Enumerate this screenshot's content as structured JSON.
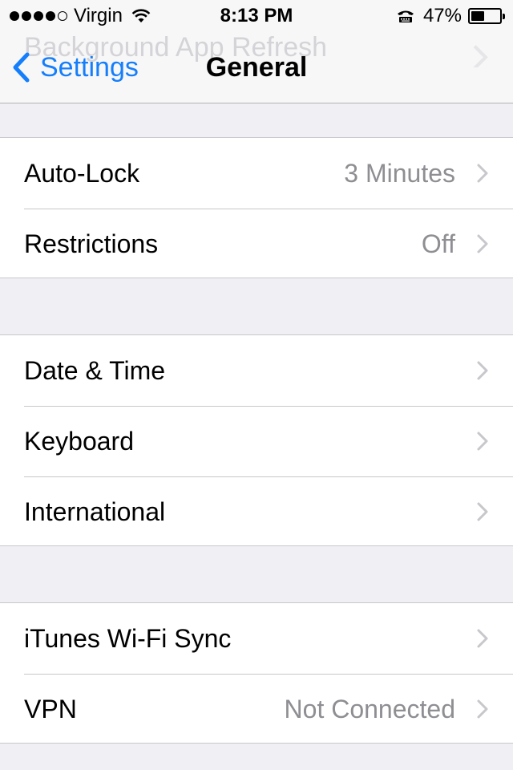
{
  "status_bar": {
    "signal_bars": 5,
    "signal_filled": 4,
    "carrier": "Virgin",
    "time": "8:13 PM",
    "battery_percent": "47%",
    "battery_level": 0.47
  },
  "nav": {
    "back_label": "Settings",
    "title": "General",
    "scrolled_under_row": "Background App Refresh"
  },
  "groups": [
    {
      "rows": [
        {
          "label": "Auto-Lock",
          "value": "3 Minutes"
        },
        {
          "label": "Restrictions",
          "value": "Off"
        }
      ]
    },
    {
      "rows": [
        {
          "label": "Date & Time",
          "value": ""
        },
        {
          "label": "Keyboard",
          "value": ""
        },
        {
          "label": "International",
          "value": ""
        }
      ]
    },
    {
      "rows": [
        {
          "label": "iTunes Wi-Fi Sync",
          "value": ""
        },
        {
          "label": "VPN",
          "value": "Not Connected"
        }
      ]
    }
  ],
  "colors": {
    "accent": "#157efb",
    "background": "#efeff4",
    "secondary_text": "#8e8e93",
    "separator": "#c8c7cc"
  },
  "icons": [
    "signal-dots",
    "wifi-icon",
    "tty-icon",
    "battery-icon",
    "back-chevron-icon",
    "chevron-right-icon"
  ]
}
